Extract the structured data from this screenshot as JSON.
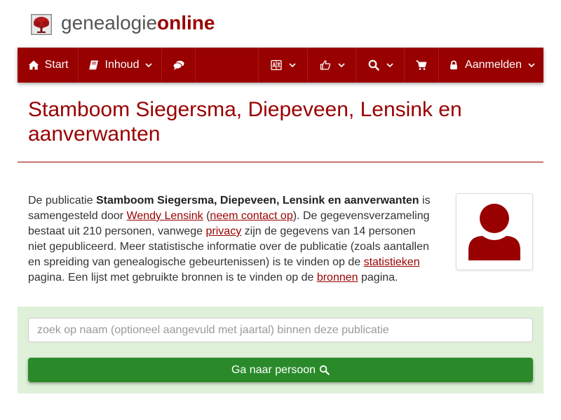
{
  "header": {
    "logo_part1": "genealogie",
    "logo_part2": "online",
    "logo_icon": "tree-icon"
  },
  "nav": {
    "start_label": "Start",
    "start_icon": "home-icon",
    "inhoud_label": "Inhoud",
    "inhoud_icon": "book-icon",
    "comments_icon": "comments-icon",
    "language_icon": "language-icon",
    "share_icon": "share-icon",
    "search_icon": "search-icon",
    "cart_icon": "shopping-cart-icon",
    "login_label": "Aanmelden",
    "login_icon": "lock-icon",
    "dropdown_icon": "chevron-down-icon"
  },
  "page": {
    "title": "Stamboom Siegersma, Diepeveen, Lensink en aanverwanten",
    "accent_color": "#990000"
  },
  "intro": {
    "t1": "De publicatie ",
    "publication_name": "Stamboom Siegersma, Diepeveen, Lensink en aanverwanten",
    "t2": " is samengesteld door ",
    "author_link": "Wendy Lensink",
    "t3": " (",
    "contact_link": "neem contact op",
    "t4": "). De gegevensverzameling bestaat uit 210 personen, vanwege ",
    "privacy_link": "privacy",
    "t5": " zijn de gegevens van 14 personen niet gepubliceerd. Meer statistische informatie over de publicatie (zoals aantallen en spreiding van genealogische gebeurtenissen) is te vinden op de ",
    "stats_link": "statistieken",
    "t6": " pagina. Een lijst met gebruikte bronnen is te vinden op de ",
    "sources_link": "bronnen",
    "t7": " pagina."
  },
  "avatar": {
    "icon": "user-icon"
  },
  "search": {
    "placeholder": "zoek op naam (optioneel aangevuld met jaartal) binnen deze publicatie",
    "value": "",
    "button_label": "Ga naar persoon ",
    "button_icon": "search-icon",
    "panel_color": "#dff0d8",
    "button_color": "#2a8a2a"
  }
}
